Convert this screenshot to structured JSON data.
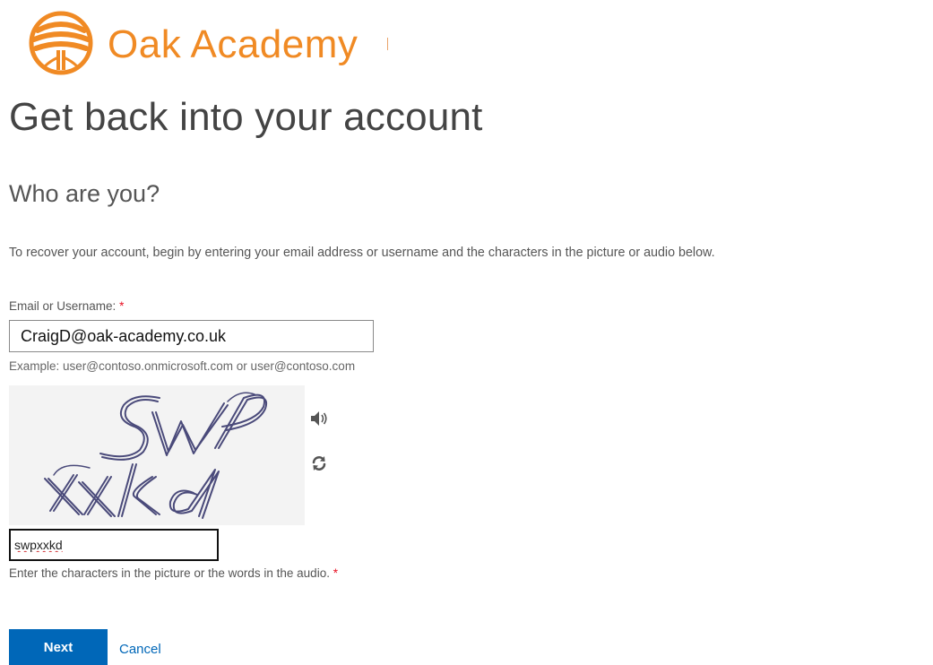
{
  "brand": {
    "name": "Oak Academy",
    "color": "#f08a24"
  },
  "page": {
    "title": "Get back into your account",
    "subtitle": "Who are you?",
    "instructions": "To recover your account, begin by entering your email address or username and the characters in the picture or audio below."
  },
  "email": {
    "label": "Email or Username:",
    "required_marker": "*",
    "value": "CraigD@oak-academy.co.uk",
    "example": "Example: user@contoso.onmicrosoft.com or user@contoso.com"
  },
  "captcha": {
    "image_text": "SWP XXKd",
    "audio_icon": "speaker-icon",
    "refresh_icon": "refresh-icon",
    "value": "swpxxkd",
    "help": "Enter the characters in the picture or the words in the audio.",
    "required_marker": "*"
  },
  "actions": {
    "next_label": "Next",
    "cancel_label": "Cancel",
    "accent": "#0067b8"
  }
}
